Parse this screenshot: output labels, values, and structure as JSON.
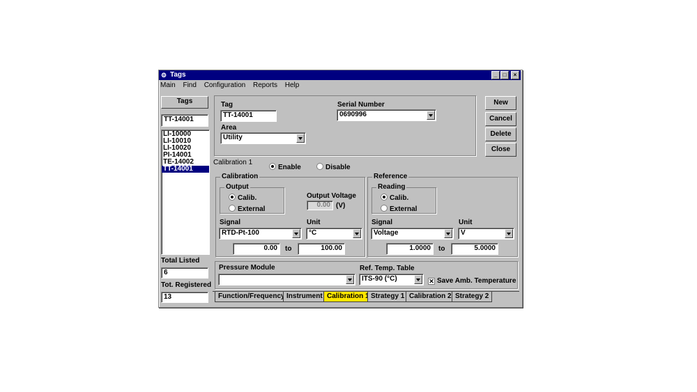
{
  "window": {
    "title": "Tags",
    "minimize": "_",
    "maximize": "□",
    "close": "×"
  },
  "menu": [
    "Main",
    "Find",
    "Configuration",
    "Reports",
    "Help"
  ],
  "left_panel": {
    "header_button": "Tags",
    "search_value": "TT-14001",
    "tags": [
      "LI-10000",
      "LI-10010",
      "LI-10020",
      "PI-14001",
      "TE-14002",
      "TT-14001"
    ],
    "selected_tag": "TT-14001",
    "total_listed_label": "Total Listed",
    "total_listed": "6",
    "tot_registered_label": "Tot. Registered",
    "tot_registered": "13"
  },
  "header": {
    "tag_label": "Tag",
    "tag_value": "TT-14001",
    "area_label": "Area",
    "area_value": "Utility",
    "serial_label": "Serial Number",
    "serial_value": "0690996"
  },
  "buttons": {
    "new": "New",
    "cancel": "Cancel",
    "delete": "Delete",
    "close": "Close"
  },
  "calibration1": {
    "label": "Calibration 1",
    "enable": "Enable",
    "disable": "Disable",
    "enabled": true
  },
  "calibration": {
    "title": "Calibration",
    "output_title": "Output",
    "calib": "Calib.",
    "external": "External",
    "output_voltage_label": "Output Voltage",
    "output_voltage": "0.00",
    "output_voltage_unit": "(V)",
    "signal_label": "Signal",
    "signal_value": "RTD-Pt-100",
    "unit_label": "Unit",
    "unit_value": "°C",
    "range_from": "0.00",
    "range_to_label": "to",
    "range_to": "100.00"
  },
  "reference": {
    "title": "Reference",
    "reading_title": "Reading",
    "calib": "Calib.",
    "external": "External",
    "signal_label": "Signal",
    "signal_value": "Voltage",
    "unit_label": "Unit",
    "unit_value": "V",
    "range_from": "1.0000",
    "range_to_label": "to",
    "range_to": "5.0000"
  },
  "bottom": {
    "pressure_module_label": "Pressure Module",
    "pressure_module_value": "",
    "ref_temp_label": "Ref. Temp. Table",
    "ref_temp_value": "ITS-90 (°C)",
    "save_amb_label": "Save Amb. Temperature",
    "save_amb_checked": true
  },
  "tabs": [
    "Function/Frequency",
    "Instrument",
    "Calibration 1",
    "Strategy 1",
    "Calibration 2",
    "Strategy 2"
  ],
  "active_tab": "Calibration 1",
  "colors": {
    "title_bar": "#000080",
    "active_tab": "#ffe600",
    "face": "#c0c0c0"
  }
}
